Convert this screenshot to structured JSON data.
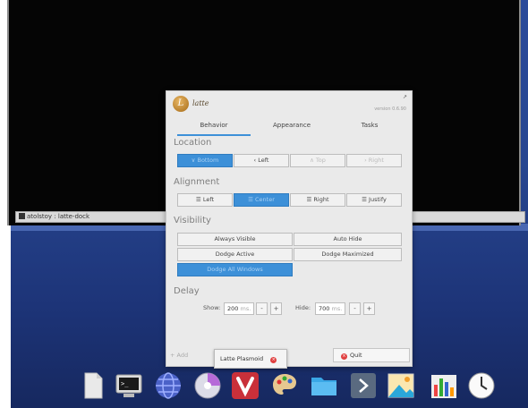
{
  "terminal": {
    "title": "atolstoy : latte-dock"
  },
  "dialog": {
    "logo_text": "latte",
    "version": "version 0.6.90",
    "tabs": [
      "Behavior",
      "Appearance",
      "Tasks"
    ],
    "active_tab": "Behavior",
    "location": {
      "title": "Location",
      "options": [
        "∨ Bottom",
        "‹ Left",
        "∧ Top",
        "› Right"
      ],
      "selected": "Bottom"
    },
    "alignment": {
      "title": "Alignment",
      "options": [
        "Left",
        "Center",
        "Right",
        "Justify"
      ],
      "selected": "Center"
    },
    "visibility": {
      "title": "Visibility",
      "options": [
        "Always Visible",
        "Auto Hide",
        "Dodge Active",
        "Dodge Maximized",
        "Dodge All Windows"
      ],
      "selected": "Dodge All Windows"
    },
    "delay": {
      "title": "Delay",
      "show_label": "Show:",
      "show_value": "200",
      "hide_label": "Hide:",
      "hide_value": "700",
      "unit": "ms."
    },
    "footer": {
      "add_label": "+ Add",
      "quit_label": "Quit"
    }
  },
  "tooltip": {
    "label": "Latte Plasmoid"
  },
  "dock": {
    "icons": [
      "file-icon",
      "terminal-icon",
      "globe-icon",
      "disc-icon",
      "vivaldi-icon",
      "palette-icon",
      "folder-icon",
      "arrow-right-icon",
      "image-viewer-icon",
      "chart-icon",
      "clock-icon"
    ]
  },
  "colors": {
    "accent": "#3d90d8",
    "desktop": "#274690",
    "close": "#e04040"
  }
}
